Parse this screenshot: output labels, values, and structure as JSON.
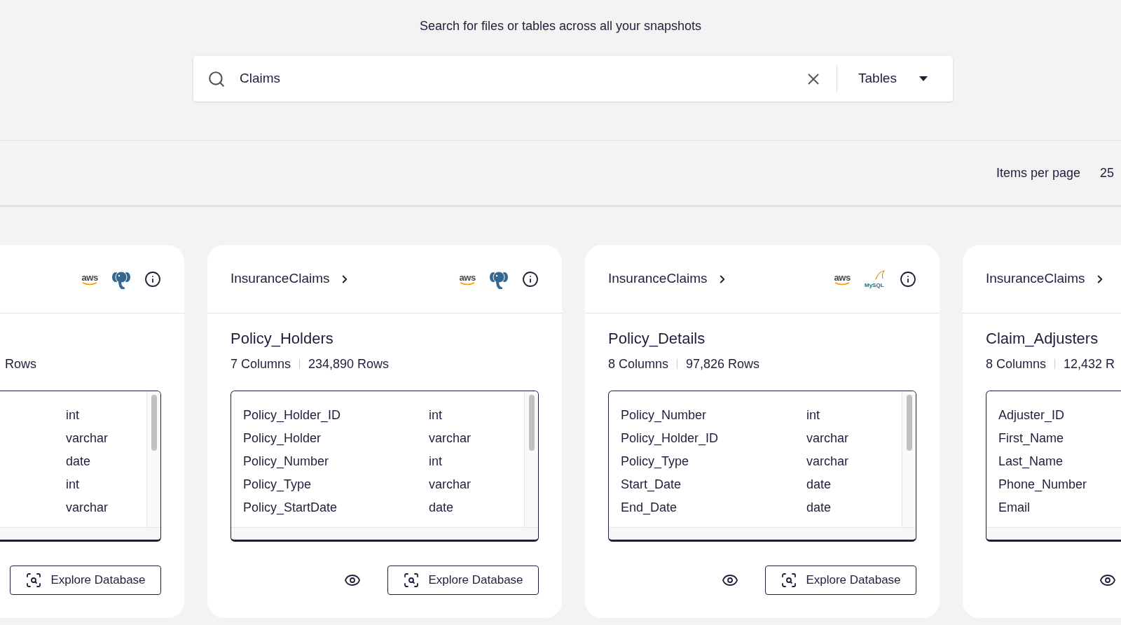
{
  "search_hint": "Search for files or tables across all your snapshots",
  "search": {
    "value": "Claims",
    "scope": "Tables"
  },
  "pagination": {
    "label": "Items per page",
    "page_size": "25"
  },
  "cards": [
    {
      "kind": "clipped",
      "sources": [
        {
          "kind": "aws",
          "label": "aws"
        },
        {
          "kind": "postgres"
        }
      ],
      "stats": {
        "rows": "Rows"
      },
      "fields": [
        {
          "type": "int"
        },
        {
          "type": "varchar"
        },
        {
          "type": "date"
        },
        {
          "type": "int"
        },
        {
          "type": "varchar"
        }
      ],
      "preview": false,
      "explore_button": "Explore Database"
    },
    {
      "kind": "full",
      "database": "InsuranceClaims",
      "sources": [
        {
          "kind": "aws",
          "label": "aws"
        },
        {
          "kind": "postgres"
        }
      ],
      "title": "Policy_Holders",
      "stats": {
        "columns": "7 Columns",
        "rows": "234,890 Rows"
      },
      "fields": [
        {
          "name": "Policy_Holder_ID",
          "type": "int"
        },
        {
          "name": "Policy_Holder",
          "type": "varchar"
        },
        {
          "name": "Policy_Number",
          "type": "int"
        },
        {
          "name": "Policy_Type",
          "type": "varchar"
        },
        {
          "name": "Policy_StartDate",
          "type": "date"
        }
      ],
      "preview": true,
      "explore_button": "Explore Database"
    },
    {
      "kind": "full",
      "database": "InsuranceClaims",
      "sources": [
        {
          "kind": "aws",
          "label": "aws"
        },
        {
          "kind": "mysql",
          "label": "MySQL"
        }
      ],
      "title": "Policy_Details",
      "stats": {
        "columns": "8 Columns",
        "rows": "97,826 Rows"
      },
      "fields": [
        {
          "name": "Policy_Number",
          "type": "int"
        },
        {
          "name": "Policy_Holder_ID",
          "type": "varchar"
        },
        {
          "name": "Policy_Type",
          "type": "varchar"
        },
        {
          "name": "Start_Date",
          "type": "date"
        },
        {
          "name": "End_Date",
          "type": "date"
        }
      ],
      "preview": true,
      "explore_button": "Explore Database"
    },
    {
      "kind": "full",
      "database": "InsuranceClaims",
      "title": "Claim_Adjusters",
      "stats": {
        "columns": "8 Columns",
        "rows": "12,432 R"
      },
      "fields": [
        {
          "name": "Adjuster_ID"
        },
        {
          "name": "First_Name"
        },
        {
          "name": "Last_Name"
        },
        {
          "name": "Phone_Number"
        },
        {
          "name": "Email"
        }
      ],
      "preview": true
    }
  ]
}
